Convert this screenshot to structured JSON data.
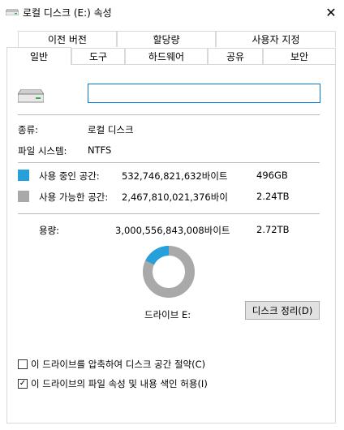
{
  "window": {
    "title": "로컬 디스크 (E:) 속성",
    "close_glyph": "✕"
  },
  "tabs_row1": [
    {
      "label": "이전 버전"
    },
    {
      "label": "할당량"
    },
    {
      "label": "사용자 지정"
    }
  ],
  "tabs_row2": [
    {
      "label": "일반",
      "active": true
    },
    {
      "label": "도구"
    },
    {
      "label": "하드웨어"
    },
    {
      "label": "공유"
    },
    {
      "label": "보안"
    }
  ],
  "general": {
    "drive_name_value": "",
    "type_label": "종류:",
    "type_value": "로컬 디스크",
    "fs_label": "파일 시스템:",
    "fs_value": "NTFS",
    "used": {
      "label": "사용 중인 공간:",
      "bytes": "532,746,821,632바이트",
      "size": "496GB",
      "color": "#26a0da"
    },
    "free": {
      "label": "사용 가능한 공간:",
      "bytes": "2,467,810,021,376바이",
      "size": "2.24TB",
      "color": "#a9a9a9"
    },
    "capacity": {
      "label": "용량:",
      "bytes": "3,000,556,843,008바이트",
      "size": "2.72TB"
    },
    "used_fraction": 0.1776,
    "drive_label": "드라이브 E:",
    "cleanup_button": "디스크 정리(D)",
    "compress_label": "이 드라이브를 압축하여 디스크 공간 절약(C)",
    "compress_checked": false,
    "index_label": "이 드라이브의 파일 속성 및 내용 색인 허용(I)",
    "index_checked": true,
    "check_glyph": "✓"
  }
}
